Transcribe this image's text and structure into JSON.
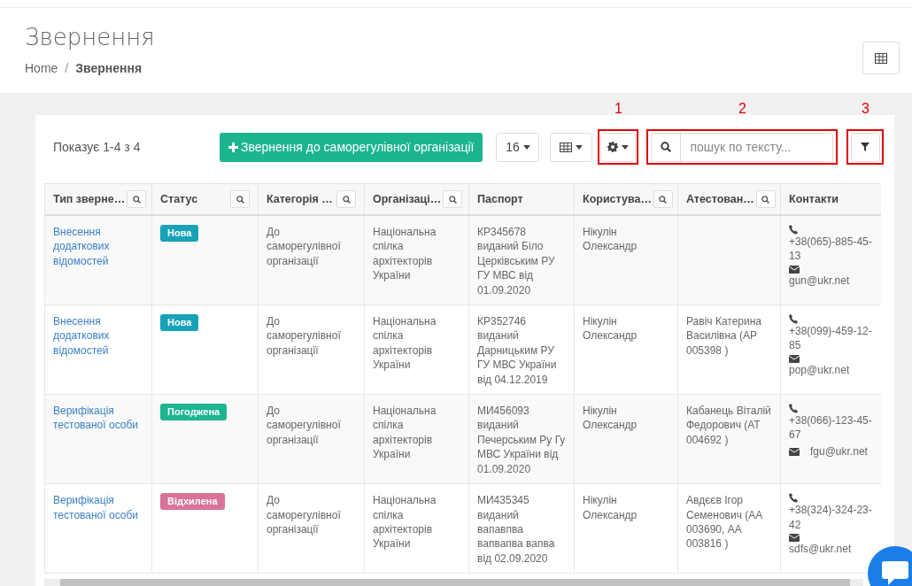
{
  "page": {
    "title": "Звернення",
    "breadcrumb_separator": "/",
    "breadcrumb": [
      {
        "label": "Home",
        "current": false
      },
      {
        "label": "Звернення",
        "current": true
      }
    ]
  },
  "toolbar": {
    "count": "Показує 1-4 з 4",
    "add_button": "Звернення до саморегулівної організації",
    "page_size": "16",
    "search": {
      "placeholder": "пошук по тексту..."
    },
    "annotations": {
      "settings": "1",
      "search": "2",
      "filter": "3"
    }
  },
  "table": {
    "columns": [
      {
        "label": "Тип зверне…",
        "searchable": true
      },
      {
        "label": "Статус",
        "searchable": true
      },
      {
        "label": "Категорія …",
        "searchable": true
      },
      {
        "label": "Організаці…",
        "searchable": true
      },
      {
        "label": "Паспорт",
        "searchable": false
      },
      {
        "label": "Користува…",
        "searchable": true
      },
      {
        "label": "Атестован…",
        "searchable": true
      },
      {
        "label": "Контакти",
        "searchable": false
      }
    ],
    "rows": [
      {
        "type": "Внесення додаткових відомостей",
        "status": {
          "label": "Нова",
          "color": "#17a2b8"
        },
        "category": "До саморегулівної організації",
        "organization": "Національна спілка архітекторів України",
        "passport": "КР345678 виданий Біло Церківським РУ ГУ МВС від 01.09.2020",
        "user": "Нікулін Олександр",
        "certified": "",
        "phone": "+38(065)-885-45-13",
        "email": "gun@ukr.net",
        "email_inline": false
      },
      {
        "type": "Внесення додаткових відомостей",
        "status": {
          "label": "Нова",
          "color": "#17a2b8"
        },
        "category": "До саморегулівної організації",
        "organization": "Національна спілка архітекторів України",
        "passport": "КР352746 виданий Дарницьким РУ ГУ МВС України від 04.12.2019",
        "user": "Нікулін Олександр",
        "certified": "Равіч Катерина Василівна (АР 005398 )",
        "phone": "+38(099)-459-12-85",
        "email": "pop@ukr.net",
        "email_inline": false
      },
      {
        "type": "Верифікація тестованої особи",
        "status": {
          "label": "Погоджена",
          "color": "#1cb58e"
        },
        "category": "До саморегулівної організації",
        "organization": "Національна спілка архітекторів України",
        "passport": "МИ456093 виданий Печерським Ру Гу МВС України від 01.09.2020",
        "user": "Нікулін Олександр",
        "certified": "Кабанець Віталій Федорович (АТ 004692 )",
        "phone": "+38(066)-123-45-67",
        "email": "fgu@ukr.net",
        "email_inline": true
      },
      {
        "type": "Верифікація тестованої особи",
        "status": {
          "label": "Відхилена",
          "color": "#d9739a"
        },
        "category": "До саморегулівної організації",
        "organization": "Національна спілка архітекторів України",
        "passport": "МИ435345 виданий вапавпва вапвапва вапва від 02.09.2020",
        "user": "Нікулін Олександр",
        "certified": "Авдєєв Ігор Семенович (АА 003690, АА 003816 )",
        "phone": "+38(324)-324-23-42",
        "email": "sdfs@ukr.net",
        "email_inline": false
      }
    ]
  }
}
